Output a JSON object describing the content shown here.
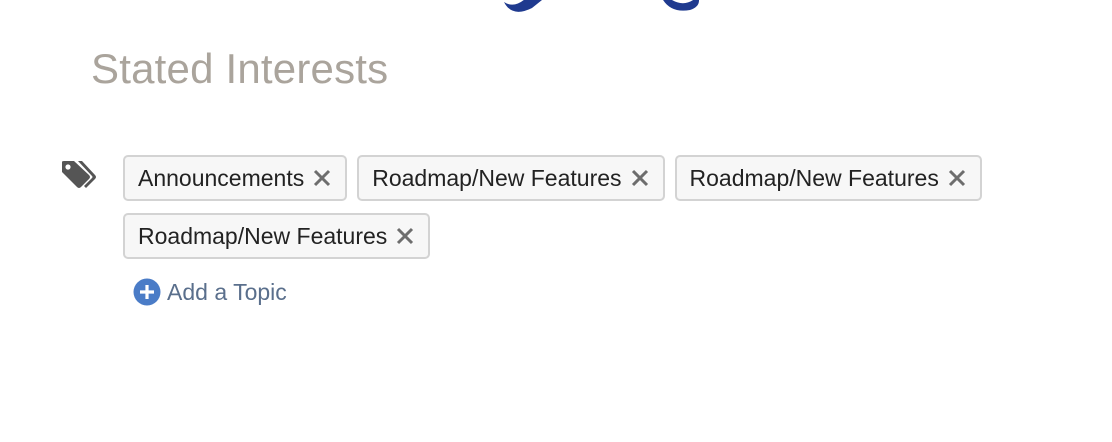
{
  "section": {
    "title": "Stated Interests"
  },
  "tags": [
    {
      "label": "Announcements",
      "remove_icon": "close-icon"
    },
    {
      "label": "Roadmap/New Features",
      "remove_icon": "close-icon"
    },
    {
      "label": "Roadmap/New Features",
      "remove_icon": "close-icon"
    },
    {
      "label": "Roadmap/New Features",
      "remove_icon": "close-icon"
    }
  ],
  "add_topic": {
    "label": "Add a Topic",
    "icon": "plus-circle-icon"
  },
  "colors": {
    "title": "#aaa49c",
    "accent_blue": "#4a7cc7",
    "link_text": "#5a6f8c",
    "top_graphic": "#1f3a8f",
    "icon_gray": "#555555"
  }
}
